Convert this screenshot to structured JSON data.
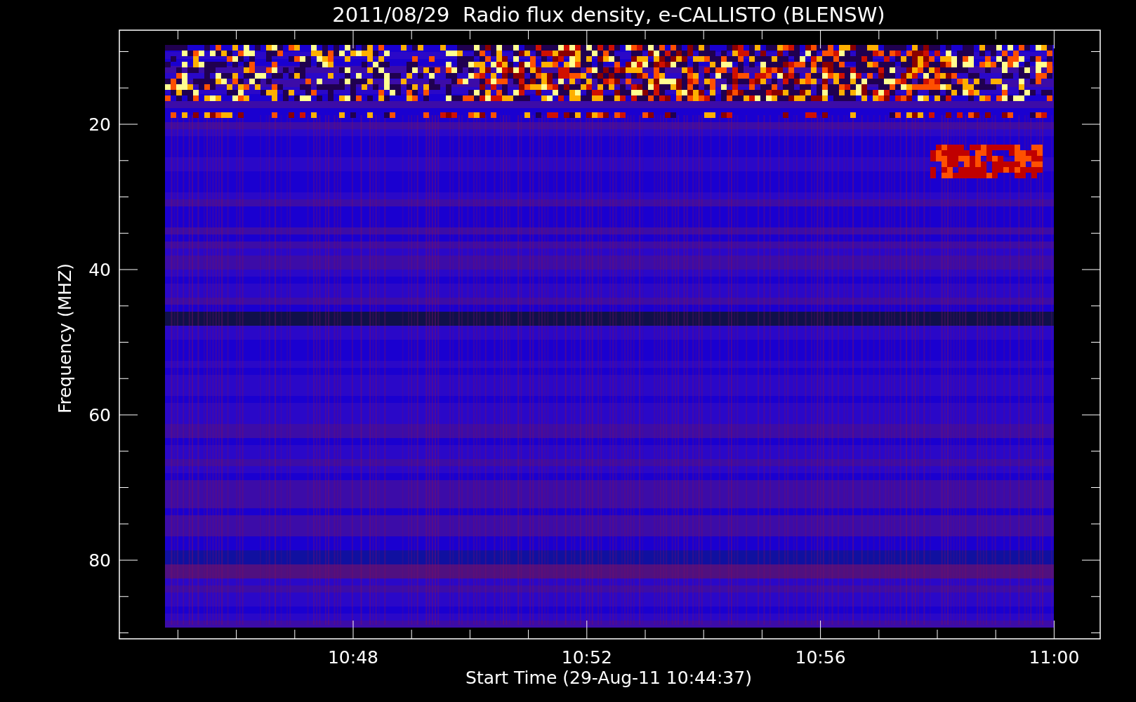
{
  "title": "2011/08/29  Radio flux density, e-CALLISTO (BLENSW)",
  "x_axis": {
    "label": "Start Time (29-Aug-11 10:44:37)",
    "ticks": [
      "10:48",
      "10:52",
      "10:56",
      "11:00"
    ]
  },
  "y_axis": {
    "label": "Frequency (MHZ)",
    "ticks": [
      "20",
      "40",
      "60",
      "80"
    ]
  }
}
